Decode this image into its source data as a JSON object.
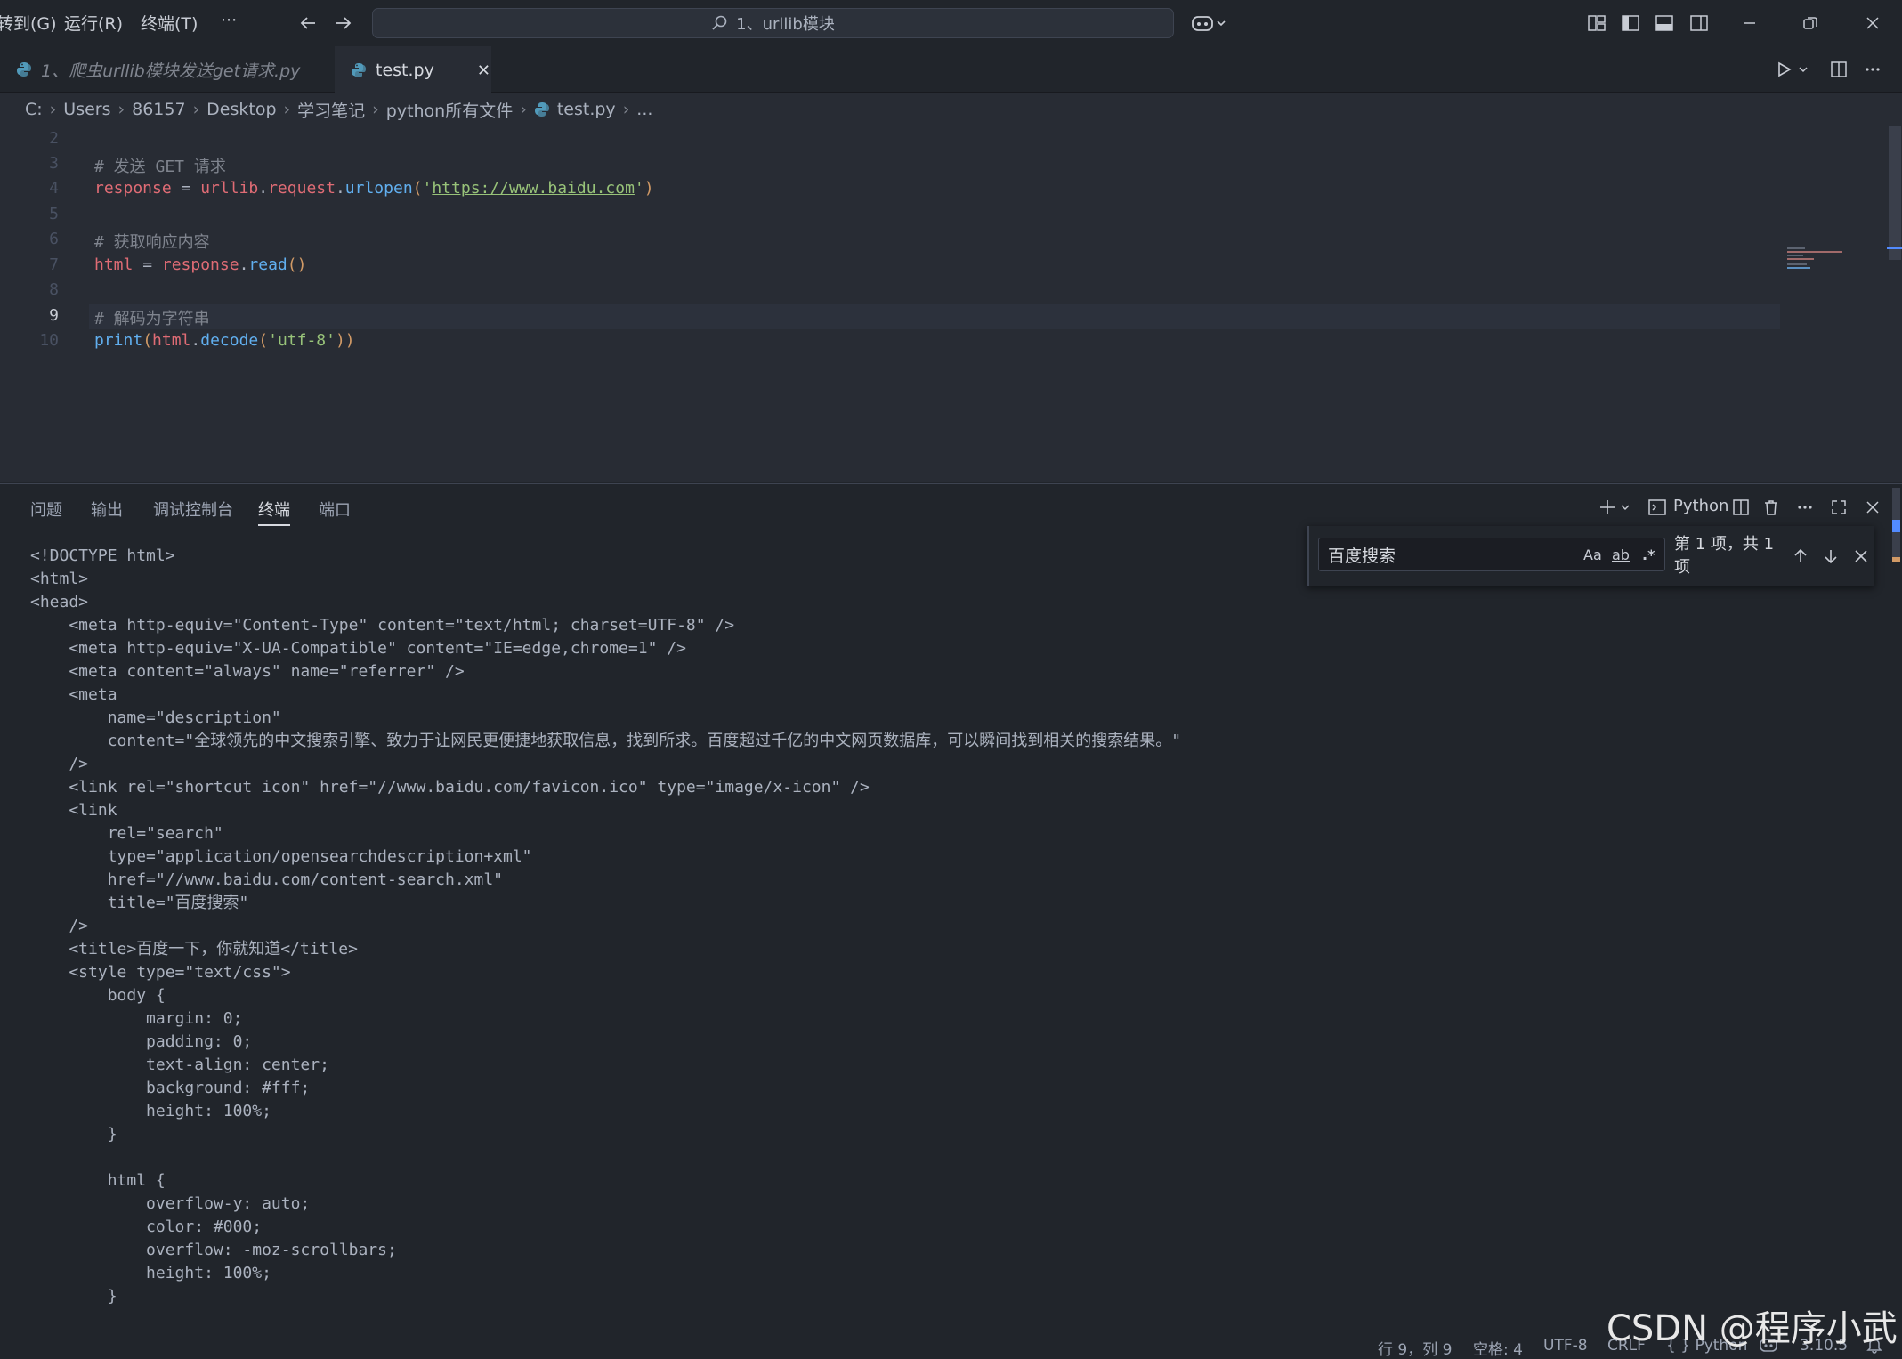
{
  "menu": {
    "goto": "转到(G)",
    "run": "运行(R)",
    "terminal": "终端(T)",
    "more": "···"
  },
  "command_center": {
    "text": "1、urllib模块"
  },
  "tabs": [
    {
      "label": "1、爬虫urllib模块发送get请求.py"
    },
    {
      "label": "test.py",
      "close": "✕"
    }
  ],
  "breadcrumb": [
    "C:",
    "Users",
    "86157",
    "Desktop",
    "学习笔记",
    "python所有文件",
    "test.py",
    "..."
  ],
  "editor": {
    "line_numbers": [
      "2",
      "3",
      "4",
      "5",
      "6",
      "7",
      "8",
      "9",
      "10"
    ],
    "comment_get": "# 发送 GET 请求",
    "var_response": "response",
    "op_eq": " = ",
    "mod_urllib": "urllib",
    "mod_request": "request",
    "fn_urlopen": "urlopen",
    "url": "https://www.baidu.com",
    "comment_read": "# 获取响应内容",
    "var_html": "html",
    "fn_read": "read",
    "comment_decode": "# 解码为字符串",
    "fn_print": "print",
    "fn_decode": "decode",
    "encoding": "'utf-8'"
  },
  "panel": {
    "tabs": [
      "问题",
      "输出",
      "调试控制台",
      "终端",
      "端口"
    ],
    "shell": "Python"
  },
  "terminal_lines": [
    "<!DOCTYPE html>",
    "<html>",
    "<head>",
    "    <meta http-equiv=\"Content-Type\" content=\"text/html; charset=UTF-8\" />",
    "    <meta http-equiv=\"X-UA-Compatible\" content=\"IE=edge,chrome=1\" />",
    "    <meta content=\"always\" name=\"referrer\" />",
    "    <meta",
    "        name=\"description\"",
    "        content=\"全球领先的中文搜索引擎、致力于让网民更便捷地获取信息，找到所求。百度超过千亿的中文网页数据库，可以瞬间找到相关的搜索结果。\"",
    "    />",
    "    <link rel=\"shortcut icon\" href=\"//www.baidu.com/favicon.ico\" type=\"image/x-icon\" />",
    "    <link",
    "        rel=\"search\"",
    "        type=\"application/opensearchdescription+xml\"",
    "        href=\"//www.baidu.com/content-search.xml\"",
    "        title=\"百度搜索\"",
    "    />",
    "    <title>百度一下，你就知道</title>",
    "    <style type=\"text/css\">",
    "        body {",
    "            margin: 0;",
    "            padding: 0;",
    "            text-align: center;",
    "            background: #fff;",
    "            height: 100%;",
    "        }",
    "",
    "        html {",
    "            overflow-y: auto;",
    "            color: #000;",
    "            overflow: -moz-scrollbars;",
    "            height: 100%;",
    "        }"
  ],
  "find": {
    "value": "百度搜索",
    "opt_case": "Aa",
    "opt_word": "ab",
    "opt_regex": ".*",
    "count": "第 1 项，共 1 项"
  },
  "status": {
    "position": "行 9，列 9",
    "spaces": "空格: 4",
    "encoding": "UTF-8",
    "eol": "CRLF",
    "language": "{ } Python",
    "version": "3.10.5"
  },
  "watermark": "CSDN @程序小武",
  "colors": {
    "bg": "#282c34",
    "panel": "#21252b",
    "string": "#98c379",
    "func": "#61afef",
    "var": "#e06c75",
    "comment": "#7f848e"
  }
}
